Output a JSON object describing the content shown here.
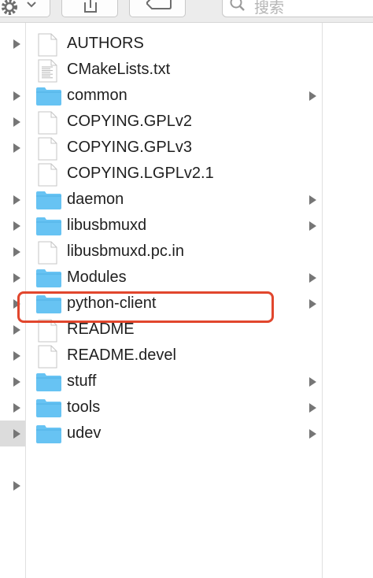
{
  "toolbar": {
    "search_placeholder": "搜索"
  },
  "left_column": {
    "rows": [
      {
        "has_arrow": true,
        "selected": false
      },
      {
        "has_arrow": false,
        "selected": false
      },
      {
        "has_arrow": true,
        "selected": false
      },
      {
        "has_arrow": true,
        "selected": false
      },
      {
        "has_arrow": true,
        "selected": false
      },
      {
        "has_arrow": false,
        "selected": false
      },
      {
        "has_arrow": true,
        "selected": false
      },
      {
        "has_arrow": true,
        "selected": false
      },
      {
        "has_arrow": true,
        "selected": false
      },
      {
        "has_arrow": true,
        "selected": false
      },
      {
        "has_arrow": true,
        "selected": false
      },
      {
        "has_arrow": true,
        "selected": false
      },
      {
        "has_arrow": true,
        "selected": false
      },
      {
        "has_arrow": true,
        "selected": false
      },
      {
        "has_arrow": true,
        "selected": false
      },
      {
        "has_arrow": true,
        "selected": true
      },
      {
        "has_arrow": false,
        "selected": false
      },
      {
        "has_arrow": true,
        "selected": false
      }
    ]
  },
  "files": [
    {
      "name": "AUTHORS",
      "type": "file",
      "has_arrow": false
    },
    {
      "name": "CMakeLists.txt",
      "type": "file-text",
      "has_arrow": false
    },
    {
      "name": "common",
      "type": "folder",
      "has_arrow": true
    },
    {
      "name": "COPYING.GPLv2",
      "type": "file",
      "has_arrow": false
    },
    {
      "name": "COPYING.GPLv3",
      "type": "file",
      "has_arrow": false
    },
    {
      "name": "COPYING.LGPLv2.1",
      "type": "file",
      "has_arrow": false
    },
    {
      "name": "daemon",
      "type": "folder",
      "has_arrow": true
    },
    {
      "name": "libusbmuxd",
      "type": "folder",
      "has_arrow": true
    },
    {
      "name": "libusbmuxd.pc.in",
      "type": "file",
      "has_arrow": false
    },
    {
      "name": "Modules",
      "type": "folder",
      "has_arrow": true
    },
    {
      "name": "python-client",
      "type": "folder",
      "has_arrow": true
    },
    {
      "name": "README",
      "type": "file",
      "has_arrow": false
    },
    {
      "name": "README.devel",
      "type": "file",
      "has_arrow": false
    },
    {
      "name": "stuff",
      "type": "folder",
      "has_arrow": true
    },
    {
      "name": "tools",
      "type": "folder",
      "has_arrow": true
    },
    {
      "name": "udev",
      "type": "folder",
      "has_arrow": true
    }
  ],
  "colors": {
    "folder": "#67c3f3",
    "highlight": "#e1462d",
    "selection": "#dcdcdc"
  }
}
